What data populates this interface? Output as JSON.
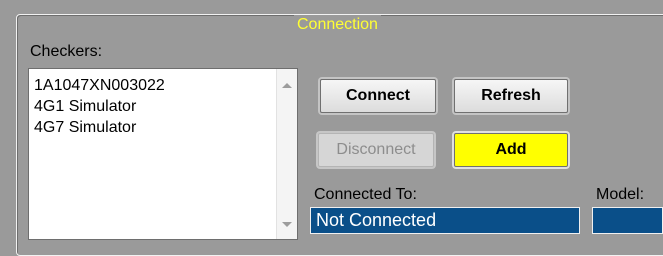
{
  "group": {
    "title": "Connection"
  },
  "checkers": {
    "label": "Checkers:",
    "items": [
      {
        "label": "1A1047XN003022"
      },
      {
        "label": "4G1 Simulator"
      },
      {
        "label": "4G7 Simulator"
      }
    ]
  },
  "buttons": {
    "connect": "Connect",
    "refresh": "Refresh",
    "disconnect": "Disconnect",
    "add": "Add"
  },
  "connected_to": {
    "label": "Connected To:",
    "value": "Not Connected"
  },
  "model": {
    "label": "Model:",
    "value": ""
  },
  "colors": {
    "background": "#9a9a9a",
    "group_title": "#ffff33",
    "add_button": "#ffff00",
    "field_background": "#0a4f89",
    "field_text": "#ffffff"
  }
}
